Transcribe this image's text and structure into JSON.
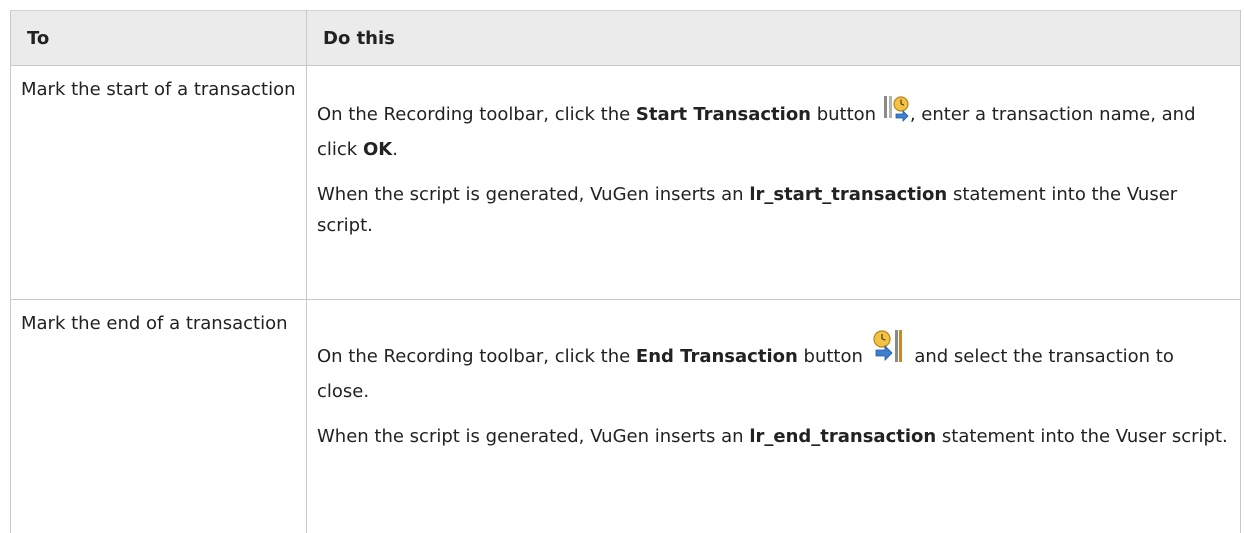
{
  "header": {
    "col_to": "To",
    "col_do": "Do this"
  },
  "rows": [
    {
      "to": "Mark the start of a transaction",
      "p1_pre": "On the Recording toolbar, click the ",
      "p1_bold": "Start Transaction",
      "p1_mid": " button ",
      "p1_post": ", enter a transaction name, and click ",
      "p1_bold2": "OK",
      "p1_end": ".",
      "p2_pre": "When the script is generated, VuGen inserts an ",
      "p2_bold": "lr_start_transaction",
      "p2_post": " statement into the Vuser script.",
      "icon": "start-transaction-icon"
    },
    {
      "to": "Mark the end of a transaction",
      "p1_pre": "On the Recording toolbar, click the ",
      "p1_bold": "End Transaction",
      "p1_mid": " button ",
      "p1_post": " and select the transaction to close.",
      "p2_pre": "When the script is generated, VuGen inserts an ",
      "p2_bold": "lr_end_transaction",
      "p2_post": " statement into the Vuser script.",
      "icon": "end-transaction-icon"
    }
  ]
}
